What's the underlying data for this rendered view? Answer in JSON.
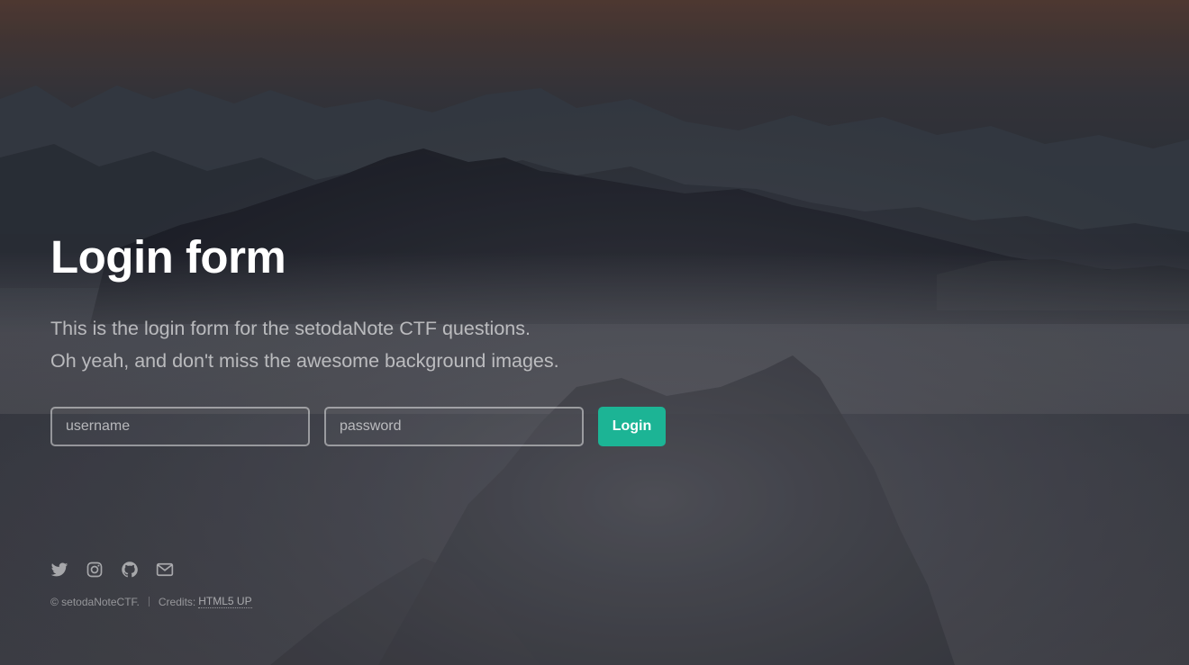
{
  "header": {
    "title": "Login form",
    "description_line1": "This is the login form for the setodaNote CTF questions.",
    "description_line2": "Oh yeah, and don't miss the awesome background images."
  },
  "form": {
    "username_placeholder": "username",
    "password_placeholder": "password",
    "username_value": "",
    "password_value": "",
    "submit_label": "Login"
  },
  "footer": {
    "icons": [
      "twitter-icon",
      "instagram-icon",
      "github-icon",
      "envelope-icon"
    ],
    "copyright": "© setodaNoteCTF.",
    "credits_label": "Credits:",
    "credits_link": "HTML5 UP"
  },
  "colors": {
    "accent": "#1cb495"
  }
}
